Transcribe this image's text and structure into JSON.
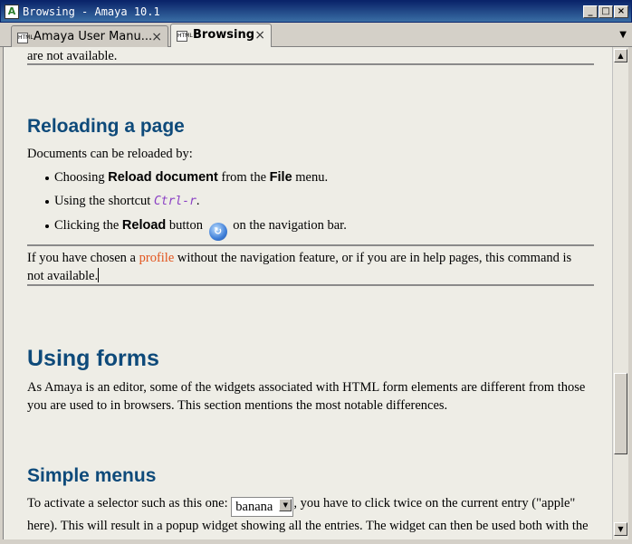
{
  "window": {
    "title": "Browsing - Amaya 10.1",
    "minimize_label": "_",
    "maximize_label": "□",
    "close_label": "×"
  },
  "tabs": [
    {
      "label": "Amaya User Manu...",
      "icon": "html-doc-icon",
      "active": false,
      "close": "×"
    },
    {
      "label": "Browsing",
      "icon": "html-doc-icon",
      "active": true,
      "close": "×"
    }
  ],
  "doc_icon_text": "HTML",
  "tab_menu_label": "▼",
  "scrollbar": {
    "up": "▲",
    "down": "▼"
  },
  "content": {
    "top_fragment": "are not available.",
    "reloading": {
      "heading": "Reloading a page",
      "intro": "Documents can be reloaded by:",
      "item1": {
        "pre": "Choosing ",
        "cmd": "Reload document",
        "mid": " from the ",
        "menu": "File",
        "post": " menu."
      },
      "item2": {
        "pre": "Using the shortcut ",
        "shortcut": "Ctrl-r",
        "post": "."
      },
      "item3": {
        "pre": "Clicking the ",
        "cmd": "Reload",
        "mid": " button ",
        "post": " on the navigation bar."
      },
      "note": {
        "pre": "If you have chosen a ",
        "link": "profile",
        "post": " without the navigation feature, or if you are in help pages, this command is not available."
      }
    },
    "forms": {
      "heading": "Using forms",
      "para": "As Amaya is an editor, some of the widgets associated with HTML form elements are different from those you are used to in browsers. This section mentions the most notable differences."
    },
    "menus": {
      "heading": "Simple menus",
      "pre": "To activate a selector such as this one: ",
      "select_value": "banana",
      "select_arrow": "▼",
      "post": ", you have to click twice on the current entry (\"apple\" here). This will result in a popup widget showing all the entries. The widget can then be used both with the"
    }
  }
}
